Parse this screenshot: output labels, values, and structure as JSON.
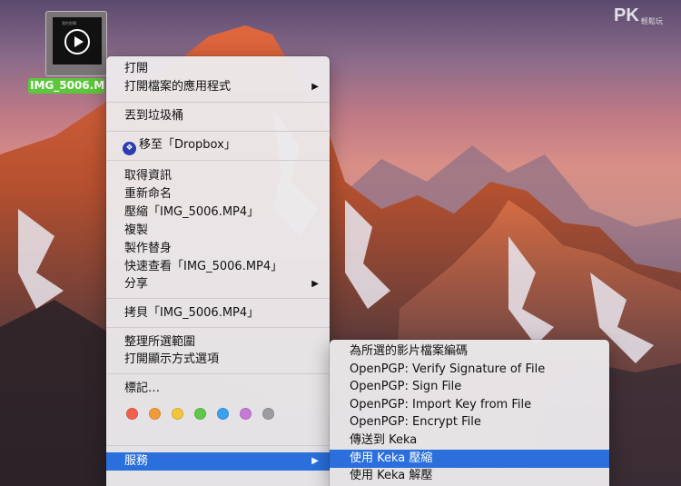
{
  "desktop": {
    "file": {
      "name": "IMG_5006.M",
      "thumbnail_caption": "我的剪輯"
    },
    "watermark": {
      "brand": "PK",
      "small": "輕鬆玩"
    }
  },
  "context_menu": {
    "items": [
      {
        "label": "打開"
      },
      {
        "label": "打開檔案的應用程式",
        "arrow": "▶"
      },
      {
        "label": "丟到垃圾桶"
      },
      {
        "label": "移至「Dropbox」"
      },
      {
        "label": "取得資訊"
      },
      {
        "label": "重新命名"
      },
      {
        "label": "壓縮「IMG_5006.MP4」"
      },
      {
        "label": "複製"
      },
      {
        "label": "製作替身"
      },
      {
        "label": "快速查看「IMG_5006.MP4」"
      },
      {
        "label": "分享",
        "arrow": "▶"
      },
      {
        "label": "拷貝「IMG_5006.MP4」"
      },
      {
        "label": "整理所選範圍"
      },
      {
        "label": "打開顯示方式選項"
      },
      {
        "label": "標記…"
      },
      {
        "label": "服務",
        "arrow": "▶"
      }
    ],
    "tag_colors": [
      "#f0604f",
      "#f29a3b",
      "#f3c43c",
      "#5fc74b",
      "#3aa0f0",
      "#c679d6",
      "#9c9c9e"
    ],
    "dropbox_glyph": "❖"
  },
  "services_submenu": {
    "items": [
      {
        "label": "為所選的影片檔案編碼"
      },
      {
        "label": "OpenPGP: Verify Signature of File"
      },
      {
        "label": "OpenPGP: Sign File"
      },
      {
        "label": "OpenPGP: Import Key from File"
      },
      {
        "label": "OpenPGP: Encrypt File"
      },
      {
        "label": "傳送到 Keka"
      },
      {
        "label": "使用 Keka 壓縮"
      },
      {
        "label": "使用 Keka 解壓"
      }
    ]
  },
  "colors": {
    "highlight": "#2a6fdb",
    "file_label": "#5cc73a"
  }
}
